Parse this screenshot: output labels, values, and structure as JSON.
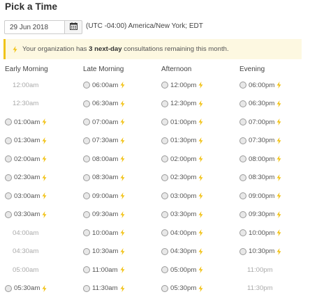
{
  "page": {
    "title": "Pick a Time",
    "date_value": "29 Jun 2018",
    "timezone": "(UTC -04:00) America/New York; EDT"
  },
  "notice": {
    "prefix": "Your organization has ",
    "highlight": "3 next-day",
    "suffix": " consultations remaining this month."
  },
  "colors": {
    "bolt": "#f2c31a",
    "notice_bg": "#fdf8e1",
    "notice_border": "#f0c419"
  },
  "columns": [
    {
      "label": "Early Morning",
      "slots": [
        {
          "time": "12:00am",
          "available": false
        },
        {
          "time": "12:30am",
          "available": false
        },
        {
          "time": "01:00am",
          "available": true
        },
        {
          "time": "01:30am",
          "available": true
        },
        {
          "time": "02:00am",
          "available": true
        },
        {
          "time": "02:30am",
          "available": true
        },
        {
          "time": "03:00am",
          "available": true
        },
        {
          "time": "03:30am",
          "available": true
        },
        {
          "time": "04:00am",
          "available": false
        },
        {
          "time": "04:30am",
          "available": false
        },
        {
          "time": "05:00am",
          "available": false
        },
        {
          "time": "05:30am",
          "available": true
        }
      ]
    },
    {
      "label": "Late Morning",
      "slots": [
        {
          "time": "06:00am",
          "available": true
        },
        {
          "time": "06:30am",
          "available": true
        },
        {
          "time": "07:00am",
          "available": true
        },
        {
          "time": "07:30am",
          "available": true
        },
        {
          "time": "08:00am",
          "available": true
        },
        {
          "time": "08:30am",
          "available": true
        },
        {
          "time": "09:00am",
          "available": true
        },
        {
          "time": "09:30am",
          "available": true
        },
        {
          "time": "10:00am",
          "available": true
        },
        {
          "time": "10:30am",
          "available": true
        },
        {
          "time": "11:00am",
          "available": true
        },
        {
          "time": "11:30am",
          "available": true
        }
      ]
    },
    {
      "label": "Afternoon",
      "slots": [
        {
          "time": "12:00pm",
          "available": true
        },
        {
          "time": "12:30pm",
          "available": true
        },
        {
          "time": "01:00pm",
          "available": true
        },
        {
          "time": "01:30pm",
          "available": true
        },
        {
          "time": "02:00pm",
          "available": true
        },
        {
          "time": "02:30pm",
          "available": true
        },
        {
          "time": "03:00pm",
          "available": true
        },
        {
          "time": "03:30pm",
          "available": true
        },
        {
          "time": "04:00pm",
          "available": true
        },
        {
          "time": "04:30pm",
          "available": true
        },
        {
          "time": "05:00pm",
          "available": true
        },
        {
          "time": "05:30pm",
          "available": true
        }
      ]
    },
    {
      "label": "Evening",
      "slots": [
        {
          "time": "06:00pm",
          "available": true
        },
        {
          "time": "06:30pm",
          "available": true
        },
        {
          "time": "07:00pm",
          "available": true
        },
        {
          "time": "07:30pm",
          "available": true
        },
        {
          "time": "08:00pm",
          "available": true
        },
        {
          "time": "08:30pm",
          "available": true
        },
        {
          "time": "09:00pm",
          "available": true
        },
        {
          "time": "09:30pm",
          "available": true
        },
        {
          "time": "10:00pm",
          "available": true
        },
        {
          "time": "10:30pm",
          "available": true
        },
        {
          "time": "11:00pm",
          "available": false
        },
        {
          "time": "11:30pm",
          "available": false
        }
      ]
    }
  ]
}
